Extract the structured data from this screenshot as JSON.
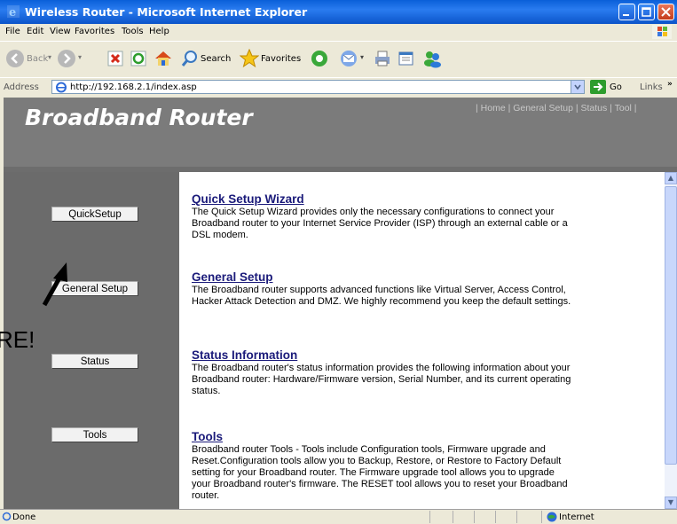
{
  "window": {
    "title": "Wireless Router - Microsoft Internet Explorer"
  },
  "menu": [
    "File",
    "Edit",
    "View",
    "Favorites",
    "Tools",
    "Help"
  ],
  "toolbar": {
    "back": "Back",
    "search": "Search",
    "favorites": "Favorites"
  },
  "address": {
    "label": "Address",
    "url": "http://192.168.2.1/index.asp",
    "go": "Go",
    "links": "Links"
  },
  "page": {
    "brand": "Broadband Router",
    "top_links": "| Home | General Setup | Status | Tool |",
    "sidebar_buttons": [
      "QuickSetup",
      "General Setup",
      "Status",
      "Tools"
    ],
    "sections": [
      {
        "title": "Quick Setup Wizard",
        "desc": "The Quick Setup Wizard provides only the necessary configurations to connect your Broadband router to your Internet Service Provider (ISP) through an external cable or a DSL modem."
      },
      {
        "title": "General Setup",
        "desc": "The Broadband router supports advanced functions like Virtual Server, Access Control, Hacker Attack Detection and DMZ. We highly recommend you keep the default settings."
      },
      {
        "title": "Status Information",
        "desc": "The Broadband router's status information provides the following information about your Broadband router: Hardware/Firmware version, Serial Number, and its current operating status."
      },
      {
        "title": "Tools",
        "desc": "Broadband router Tools - Tools include Configuration tools, Firmware upgrade and Reset.Configuration tools allow you to Backup, Restore, or Restore to Factory Default setting for your Broadband router. The Firmware upgrade tool allows you to upgrade your Broadband router's firmware. The RESET tool allows you to reset your Broadband router."
      }
    ]
  },
  "annotation": {
    "text": "RE!"
  },
  "statusbar": {
    "left": "Done",
    "zone": "Internet"
  }
}
